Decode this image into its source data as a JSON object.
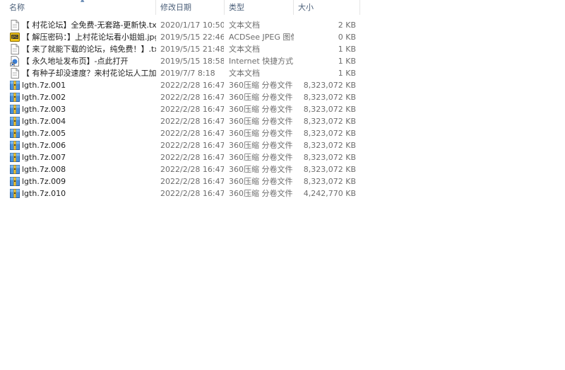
{
  "columns": {
    "name": "名称",
    "date": "修改日期",
    "type": "类型",
    "size": "大小"
  },
  "files": [
    {
      "name": "【 村花论坛】全免费-无套路-更新快.txt",
      "date": "2020/1/17 10:50",
      "type": "文本文档",
      "size": "2 KB",
      "icon": "text-file-icon"
    },
    {
      "name": "【 解压密码：】上村花论坛看小姐姐.jpg",
      "date": "2019/5/15 22:46",
      "type": "ACDSee JPEG 图像",
      "size": "0 KB",
      "icon": "jpeg-image-icon"
    },
    {
      "name": "【 来了就能下载的论坛，纯免费！】.txt",
      "date": "2019/5/15 21:48",
      "type": "文本文档",
      "size": "1 KB",
      "icon": "text-file-icon"
    },
    {
      "name": "【 永久地址发布页】-点此打开",
      "date": "2019/5/15 18:58",
      "type": "Internet 快捷方式",
      "size": "1 KB",
      "icon": "internet-shortcut-icon"
    },
    {
      "name": "【 有种子却没速度？来村花论坛人工加…",
      "date": "2019/7/7 8:18",
      "type": "文本文档",
      "size": "1 KB",
      "icon": "text-file-icon"
    },
    {
      "name": "lgth.7z.001",
      "date": "2022/2/28 16:47",
      "type": "360压缩 分卷文件",
      "size": "8,323,072 KB",
      "icon": "archive-volume-icon"
    },
    {
      "name": "lgth.7z.002",
      "date": "2022/2/28 16:47",
      "type": "360压缩 分卷文件",
      "size": "8,323,072 KB",
      "icon": "archive-volume-icon"
    },
    {
      "name": "lgth.7z.003",
      "date": "2022/2/28 16:47",
      "type": "360压缩 分卷文件",
      "size": "8,323,072 KB",
      "icon": "archive-volume-icon"
    },
    {
      "name": "lgth.7z.004",
      "date": "2022/2/28 16:47",
      "type": "360压缩 分卷文件",
      "size": "8,323,072 KB",
      "icon": "archive-volume-icon"
    },
    {
      "name": "lgth.7z.005",
      "date": "2022/2/28 16:47",
      "type": "360压缩 分卷文件",
      "size": "8,323,072 KB",
      "icon": "archive-volume-icon"
    },
    {
      "name": "lgth.7z.006",
      "date": "2022/2/28 16:47",
      "type": "360压缩 分卷文件",
      "size": "8,323,072 KB",
      "icon": "archive-volume-icon"
    },
    {
      "name": "lgth.7z.007",
      "date": "2022/2/28 16:47",
      "type": "360压缩 分卷文件",
      "size": "8,323,072 KB",
      "icon": "archive-volume-icon"
    },
    {
      "name": "lgth.7z.008",
      "date": "2022/2/28 16:47",
      "type": "360压缩 分卷文件",
      "size": "8,323,072 KB",
      "icon": "archive-volume-icon"
    },
    {
      "name": "lgth.7z.009",
      "date": "2022/2/28 16:47",
      "type": "360压缩 分卷文件",
      "size": "8,323,072 KB",
      "icon": "archive-volume-icon"
    },
    {
      "name": "lgth.7z.010",
      "date": "2022/2/28 16:47",
      "type": "360压缩 分卷文件",
      "size": "4,242,770 KB",
      "icon": "archive-volume-icon"
    }
  ]
}
